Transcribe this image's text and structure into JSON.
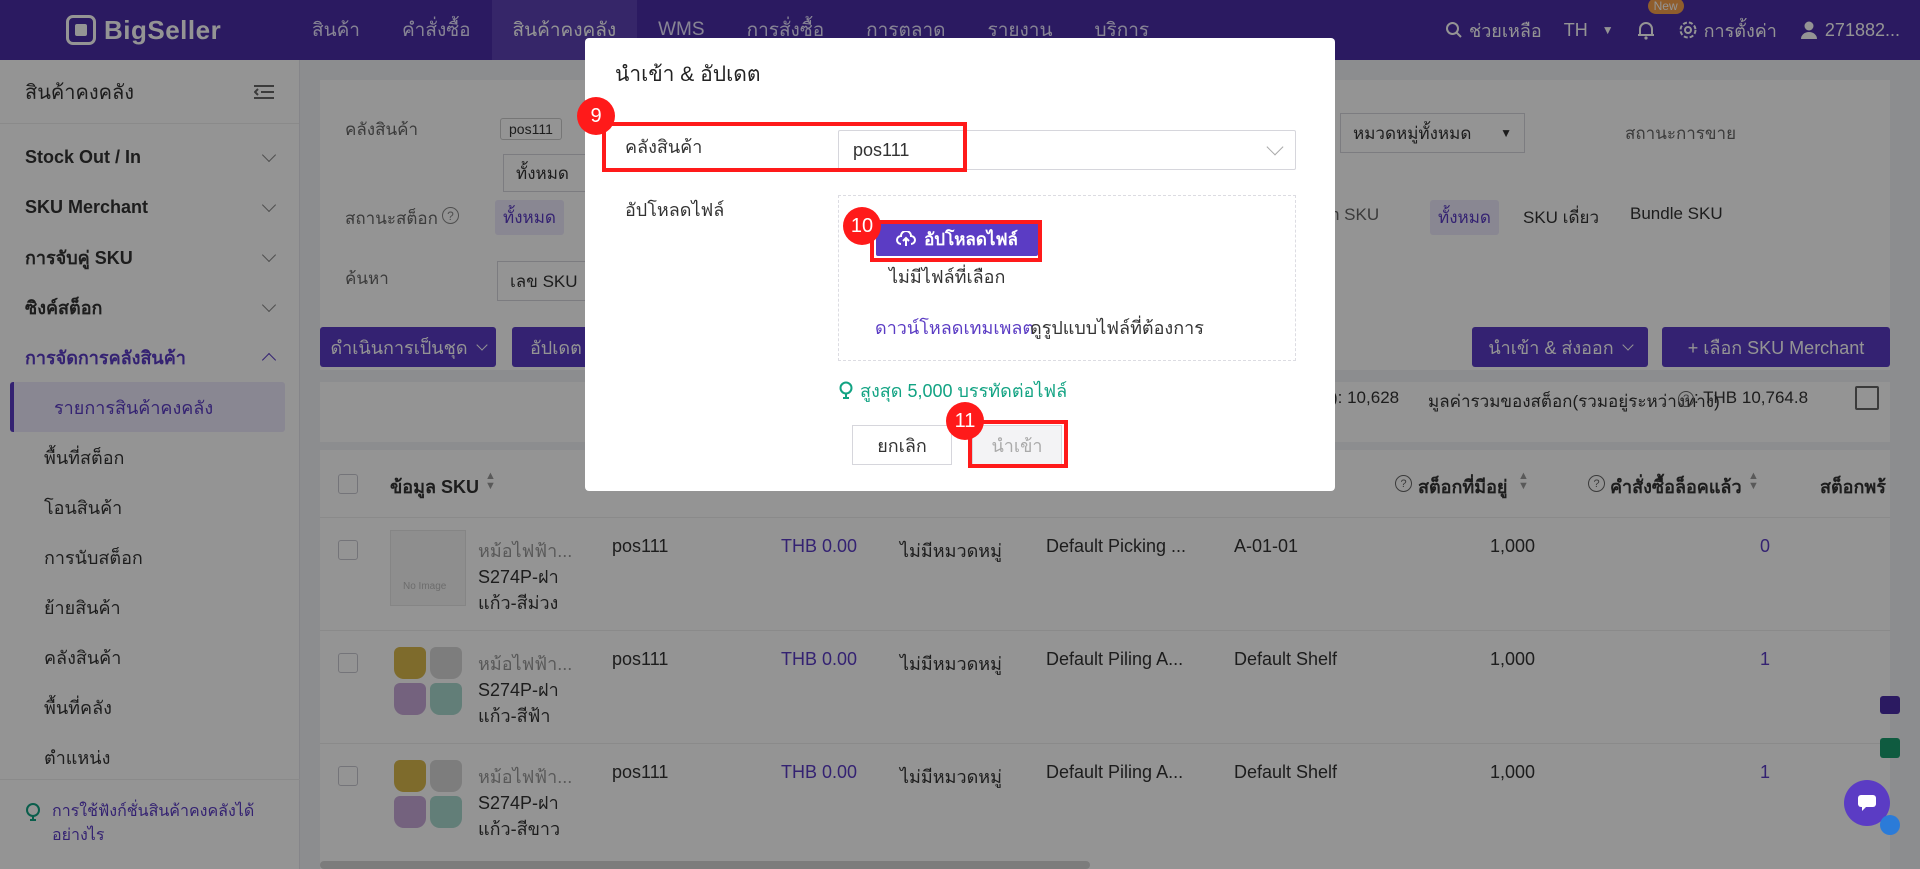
{
  "topbar": {
    "logo": "BigSeller",
    "nav": [
      "สินค้า",
      "คำสั่งซื้อ",
      "สินค้าคงคลัง",
      "WMS",
      "การสั่งซื้อ",
      "การตลาด",
      "รายงาน",
      "บริการ"
    ],
    "help": "ช่วยเหลือ",
    "lang": "TH",
    "new_badge": "New",
    "settings": "การตั้งค่า",
    "user": "271882..."
  },
  "sidebar": {
    "title": "สินค้าคงคลัง",
    "groups": [
      "Stock Out / In",
      "SKU Merchant",
      "การจับคู่ SKU",
      "ซิงค์สต็อก",
      "การจัดการคลังสินค้า"
    ],
    "subitems": [
      "รายการสินค้าคงคลัง",
      "พื้นที่สต็อก",
      "โอนสินค้า",
      "การนับสต็อก",
      "ย้ายสินค้า",
      "คลังสินค้า",
      "พื้นที่คลัง",
      "ตำแหน่ง"
    ],
    "footer": "การใช้ฟังก์ชั่นสินค้าคงคลังได้อย่างไร"
  },
  "filters": {
    "warehouse_label": "คลังสินค้า",
    "warehouse_chip": "pos111",
    "all": "ทั้งหมด",
    "category_select": "หมวดหมู่ทั้งหมด",
    "sale_status_label": "สถานะการขาย",
    "stock_status_label": "สถานะสต็อก",
    "sku_type_partial": "n SKU",
    "single_sku": "SKU เดี่ยว",
    "bundle_sku": "Bundle SKU",
    "search_label": "ค้นหา",
    "search_field": "เลข SKU",
    "batch_btn": "ดำเนินการเป็นชุด",
    "update_btn": "อัปเดต",
    "import_export_btn": "นำเข้า & ส่งออก",
    "select_sku_btn": "+ เลือก SKU Merchant"
  },
  "stats": {
    "count_partial": "): 10,628",
    "value_label": "มูลค่ารวมของสต็อก(รวมอยู่ระหว่างทาง)",
    "value_amount": ": THB 10,764.8"
  },
  "table": {
    "headers": [
      "ข้อมูล SKU",
      "สต็อกที่มีอยู่",
      "คำสั่งซื้อล็อคแล้ว",
      "สต็อกพร้"
    ],
    "rows": [
      {
        "name": "หม้อไฟฟ้า...",
        "sku1": "S274P-ฝา",
        "sku2": "แก้ว-สีม่วง",
        "warehouse": "pos111",
        "price": "THB 0.00",
        "category": "ไม่มีหมวดหมู่",
        "area": "Default Picking ...",
        "shelf": "A-01-01",
        "stock": "1,000",
        "locked": "0",
        "no_image": "No Image"
      },
      {
        "name": "หม้อไฟฟ้า...",
        "sku1": "S274P-ฝา",
        "sku2": "แก้ว-สีฟ้า",
        "warehouse": "pos111",
        "price": "THB 0.00",
        "category": "ไม่มีหมวดหมู่",
        "area": "Default Piling A...",
        "shelf": "Default Shelf",
        "stock": "1,000",
        "locked": "1"
      },
      {
        "name": "หม้อไฟฟ้า...",
        "sku1": "S274P-ฝา",
        "sku2": "แก้ว-สีขาว",
        "warehouse": "pos111",
        "price": "THB 0.00",
        "category": "ไม่มีหมวดหมู่",
        "area": "Default Piling A...",
        "shelf": "Default Shelf",
        "stock": "1,000",
        "locked": "1"
      }
    ]
  },
  "modal": {
    "title": "นำเข้า & อัปเดต",
    "warehouse_label": "คลังสินค้า",
    "warehouse_value": "pos111",
    "upload_label": "อัปโหลดไฟล์",
    "upload_btn": "อัปโหลดไฟล์",
    "no_file": "ไม่มีไฟล์ที่เลือก",
    "download_template": "ดาวน์โหลดเทมเพลต",
    "template_hint": "ดูรูปแบบไฟล์ที่ต้องการ",
    "limit_hint": "สูงสุด 5,000 บรรทัดต่อไฟล์",
    "cancel": "ยกเลิก",
    "import": "นำเข้า"
  },
  "annotations": {
    "step9": "9",
    "step10": "10",
    "step11": "11"
  },
  "colors": {
    "brand": "#4a2da8",
    "accent": "#5b3cc4",
    "highlight": "#ff1a1a",
    "hint": "#12a383"
  }
}
